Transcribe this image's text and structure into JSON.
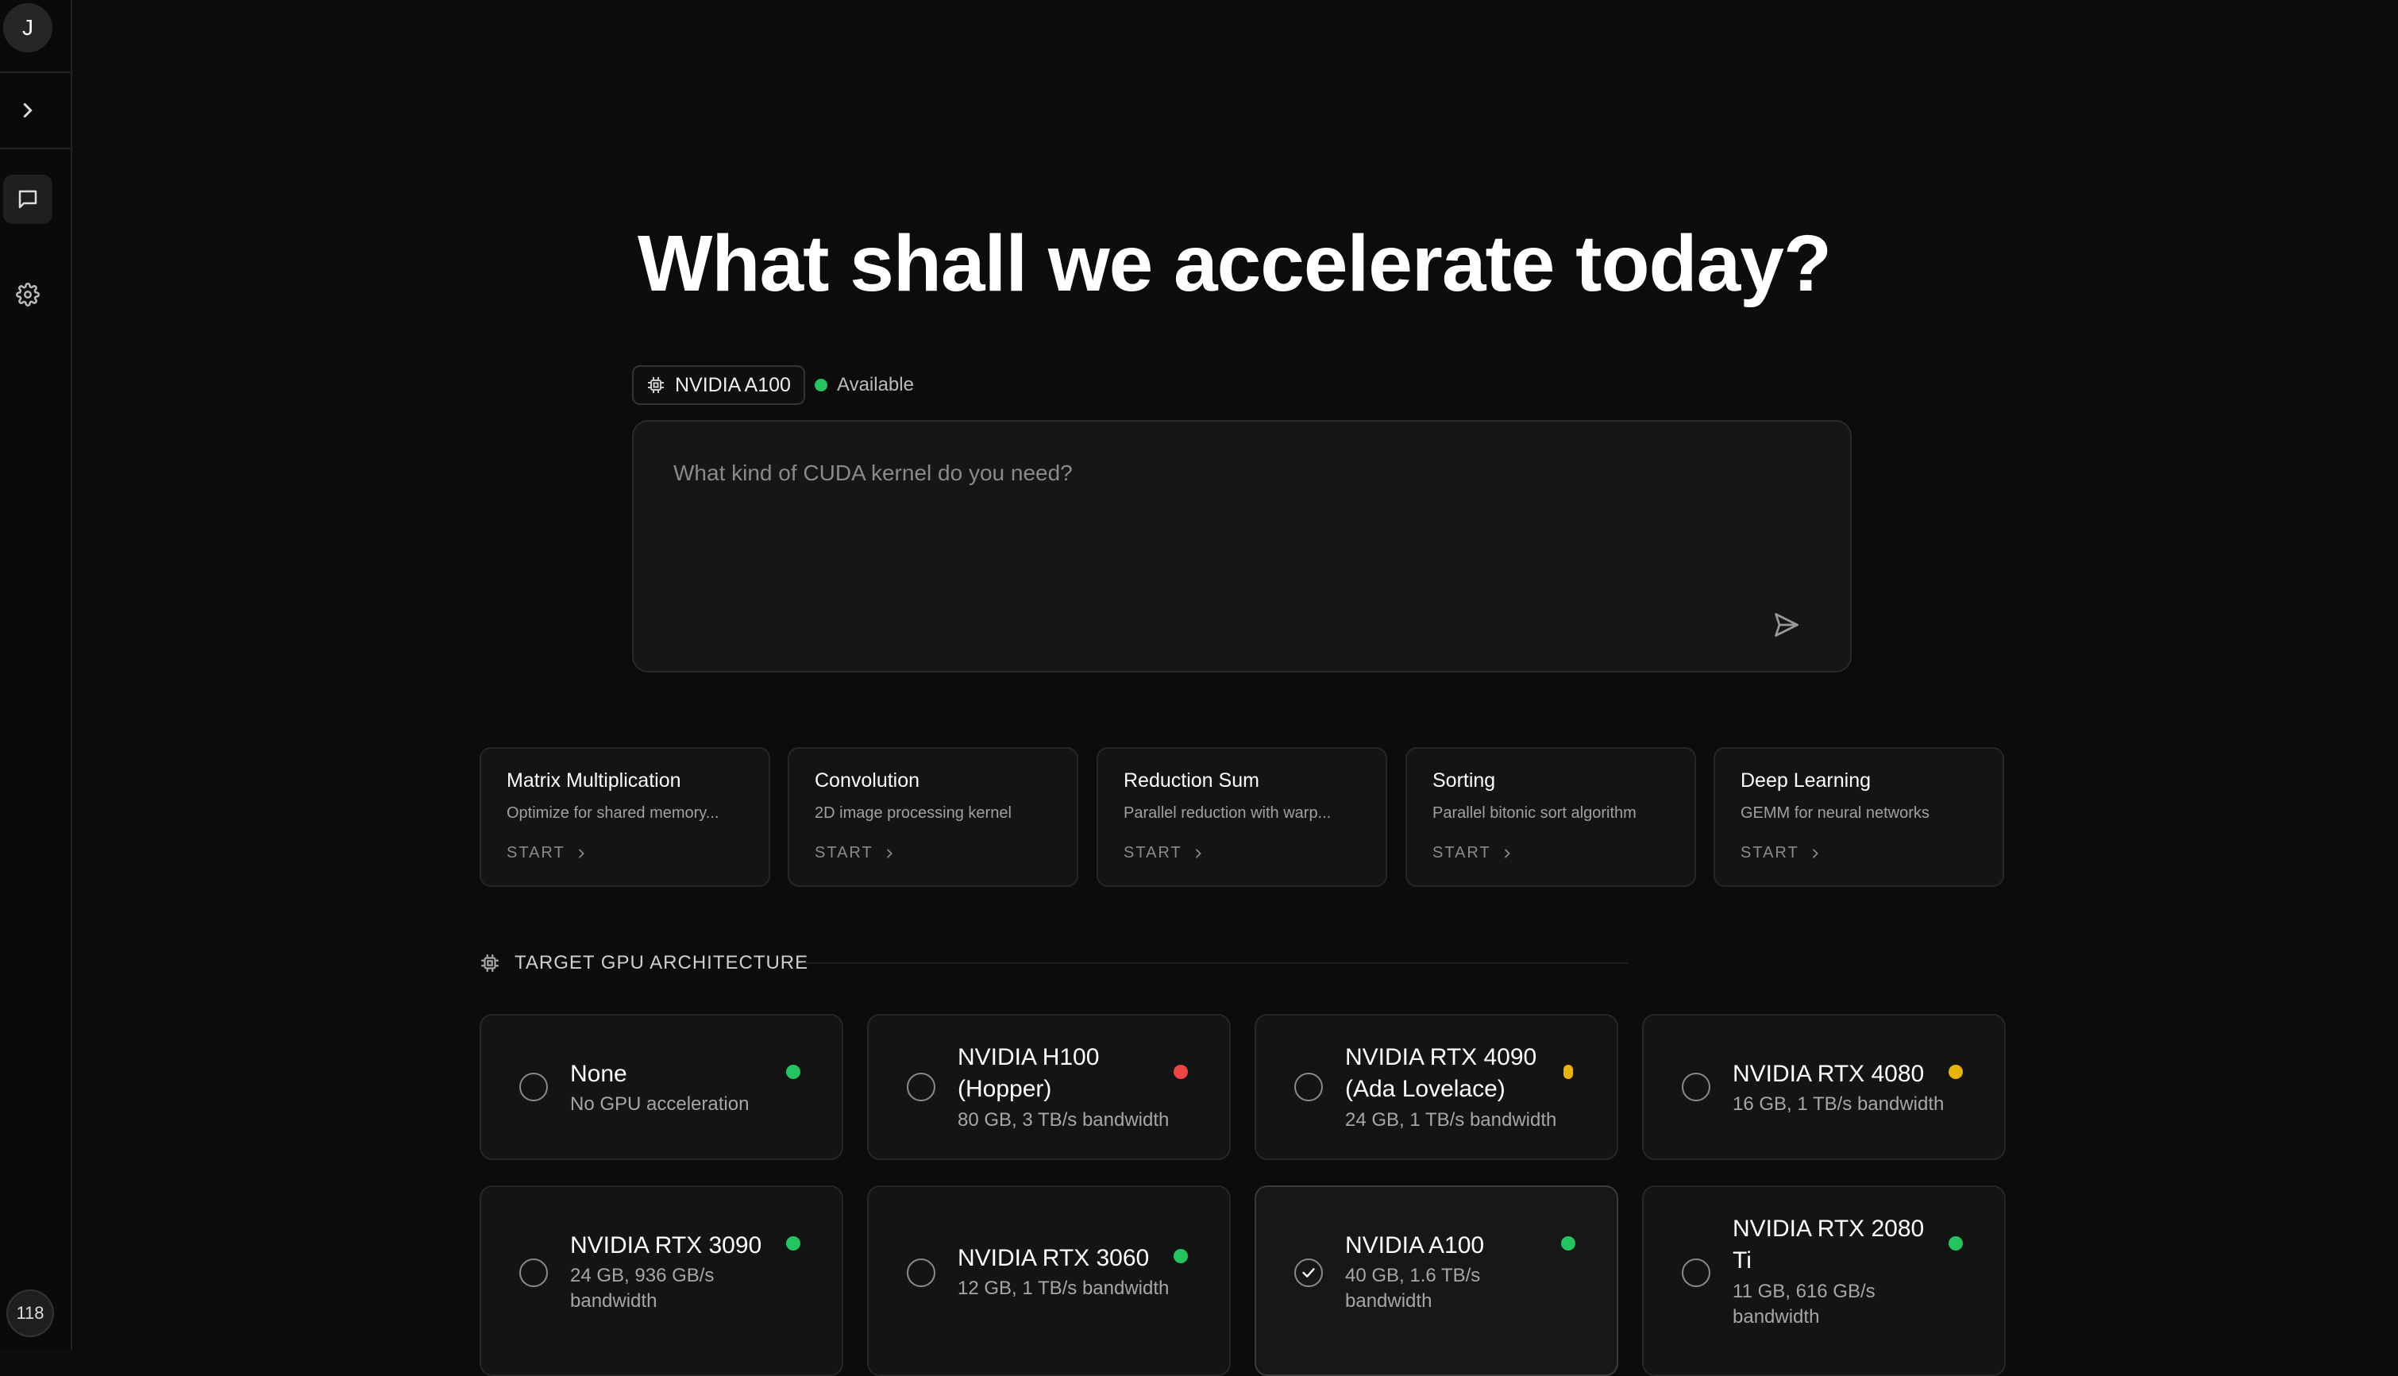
{
  "sidebar": {
    "avatar_initial": "J",
    "counter": "118",
    "icons": [
      "chevron-right-icon",
      "chat-icon",
      "gear-icon"
    ]
  },
  "headline": "What shall we accelerate today?",
  "gpu_chip": {
    "label": "NVIDIA A100",
    "icon": "chip-icon"
  },
  "status": {
    "label": "Available",
    "color": "#22c55e"
  },
  "prompt": {
    "placeholder": "What kind of CUDA kernel do you need?",
    "value": ""
  },
  "suggestions": [
    {
      "title": "Matrix Multiplication",
      "desc": "Optimize for shared memory...",
      "action": "START"
    },
    {
      "title": "Convolution",
      "desc": "2D image processing kernel",
      "action": "START"
    },
    {
      "title": "Reduction Sum",
      "desc": "Parallel reduction with warp...",
      "action": "START"
    },
    {
      "title": "Sorting",
      "desc": "Parallel bitonic sort algorithm",
      "action": "START"
    },
    {
      "title": "Deep Learning",
      "desc": "GEMM for neural networks",
      "action": "START"
    }
  ],
  "section_title": "TARGET GPU ARCHITECTURE",
  "colors": {
    "green": "#22c55e",
    "red": "#ef4444",
    "yellow": "#eab308"
  },
  "gpus": [
    {
      "name": "None",
      "spec": "No GPU acceleration",
      "status_color": "#22c55e",
      "selected": false
    },
    {
      "name": "NVIDIA H100 (Hopper)",
      "spec": "80 GB, 3 TB/s bandwidth",
      "status_color": "#ef4444",
      "selected": false
    },
    {
      "name": "NVIDIA RTX 4090 (Ada Lovelace)",
      "spec": "24 GB, 1 TB/s bandwidth",
      "status_color": "#eab308",
      "selected": false
    },
    {
      "name": "NVIDIA RTX 4080",
      "spec": "16 GB, 1 TB/s bandwidth",
      "status_color": "#eab308",
      "selected": false
    },
    {
      "name": "NVIDIA RTX 3090",
      "spec": "24 GB, 936 GB/s bandwidth",
      "status_color": "#22c55e",
      "selected": false
    },
    {
      "name": "NVIDIA RTX 3060",
      "spec": "12 GB, 1 TB/s bandwidth",
      "status_color": "#22c55e",
      "selected": false
    },
    {
      "name": "NVIDIA A100",
      "spec": "40 GB, 1.6 TB/s bandwidth",
      "status_color": "#22c55e",
      "selected": true
    },
    {
      "name": "NVIDIA RTX 2080 Ti",
      "spec": "11 GB, 616 GB/s bandwidth",
      "status_color": "#22c55e",
      "selected": false
    }
  ]
}
